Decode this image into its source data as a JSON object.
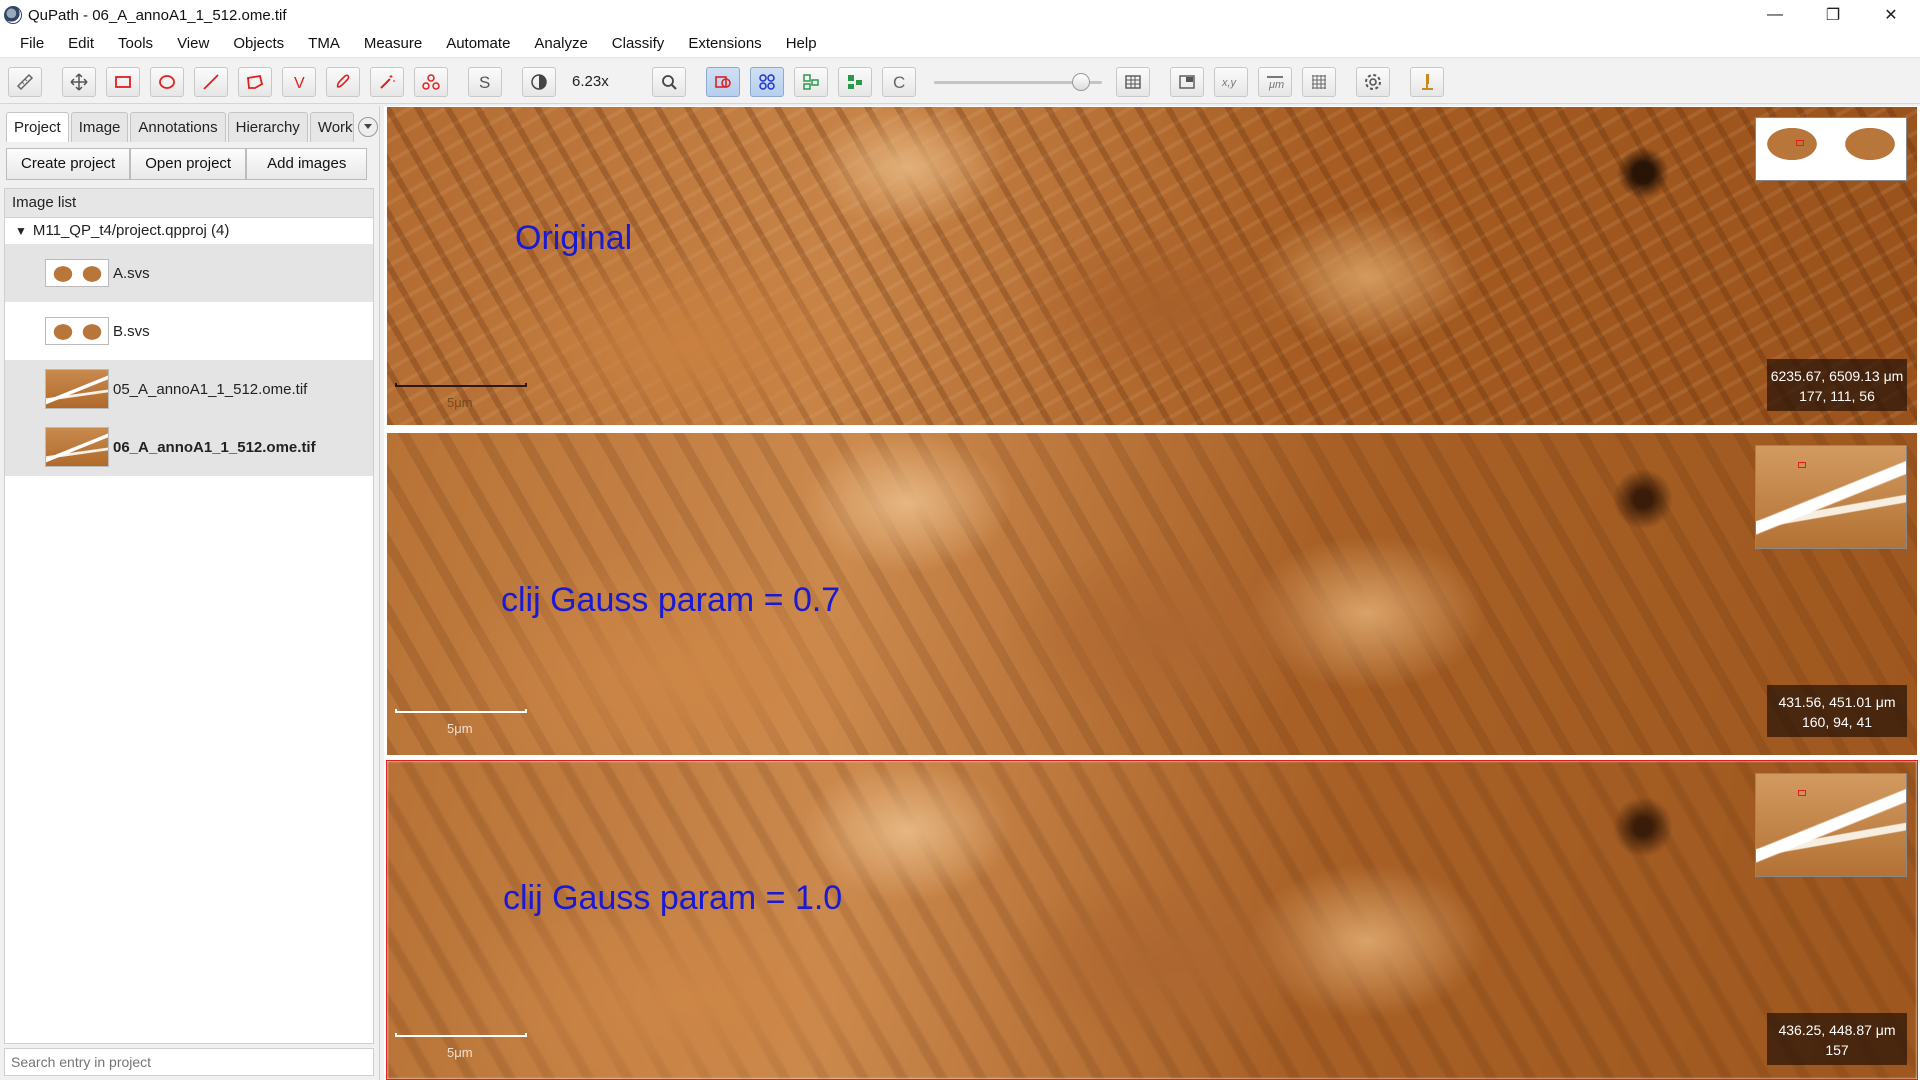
{
  "window": {
    "title": "QuPath - 06_A_annoA1_1_512.ome.tif",
    "minimize": "—",
    "maximize": "❐",
    "close": "✕"
  },
  "menu": [
    "File",
    "Edit",
    "Tools",
    "View",
    "Objects",
    "TMA",
    "Measure",
    "Automate",
    "Analyze",
    "Classify",
    "Extensions",
    "Help"
  ],
  "toolbar": {
    "zoom": "6.23x",
    "zoom_slider_fraction": 0.92,
    "slider_label": "S",
    "c_label": "C",
    "v_label": "V",
    "xy_label": "x,y",
    "um_label": "μm"
  },
  "left_panel": {
    "tabs": [
      "Project",
      "Image",
      "Annotations",
      "Hierarchy",
      "Workf"
    ],
    "buttons": {
      "create": "Create project",
      "open": "Open project",
      "add": "Add images"
    },
    "image_list_label": "Image list",
    "root": "M11_QP_t4/project.qpproj (4)",
    "entries": [
      "A.svs",
      "B.svs",
      "05_A_annoA1_1_512.ome.tif",
      "06_A_annoA1_1_512.ome.tif"
    ],
    "search_placeholder": "Search entry in project"
  },
  "viewers": [
    {
      "label": "Original",
      "scale": "5μm",
      "coords1": "6235.67, 6509.13 μm",
      "coords2": "177, 111, 56"
    },
    {
      "label": "clij Gauss param = 0.7",
      "scale": "5μm",
      "coords1": "431.56, 451.01 μm",
      "coords2": "160, 94, 41"
    },
    {
      "label": "clij Gauss param = 1.0",
      "scale": "5μm",
      "coords1": "436.25, 448.87 μm",
      "coords2": "157"
    }
  ],
  "colors": {
    "annotation_text": "#1a1ad2",
    "active_border": "#e02020"
  }
}
